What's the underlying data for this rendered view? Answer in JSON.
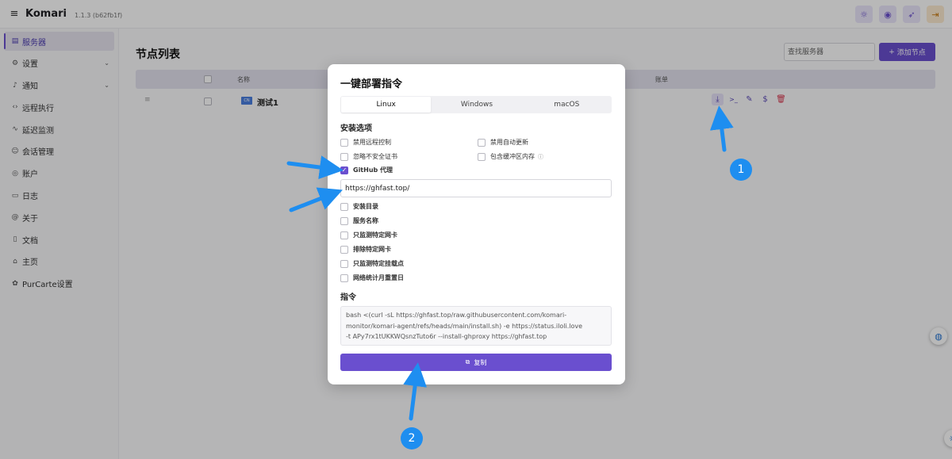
{
  "header": {
    "menu_icon": "hamburger-icon",
    "brand": "Komari",
    "version": "1.1.3 (b62fb1f)",
    "actions": [
      {
        "icon": "sun-icon",
        "glyph": "☼"
      },
      {
        "icon": "palette-icon",
        "glyph": "◉"
      },
      {
        "icon": "rocket-icon",
        "glyph": "➶"
      },
      {
        "icon": "logout-icon",
        "glyph": "⇥"
      }
    ]
  },
  "sidebar": {
    "items": [
      {
        "label": "服务器",
        "icon": "server-icon",
        "glyph": "▤",
        "active": true
      },
      {
        "label": "设置",
        "icon": "gear-icon",
        "glyph": "⚙",
        "chevron": true
      },
      {
        "label": "通知",
        "icon": "bell-icon",
        "glyph": "♪",
        "chevron": true
      },
      {
        "label": "远程执行",
        "icon": "code-icon",
        "glyph": "‹›"
      },
      {
        "label": "延迟监测",
        "icon": "pulse-icon",
        "glyph": "∿"
      },
      {
        "label": "会话管理",
        "icon": "users-icon",
        "glyph": "☺"
      },
      {
        "label": "账户",
        "icon": "user-circle-icon",
        "glyph": "◎"
      },
      {
        "label": "日志",
        "icon": "file-icon",
        "glyph": "▭"
      },
      {
        "label": "关于",
        "icon": "at-icon",
        "glyph": "@"
      },
      {
        "label": "文档",
        "icon": "book-icon",
        "glyph": "▯"
      },
      {
        "label": "主页",
        "icon": "home-icon",
        "glyph": "⌂"
      },
      {
        "label": "PurCarte设置",
        "icon": "palette-icon",
        "glyph": "✿"
      }
    ]
  },
  "main": {
    "title": "节点列表",
    "search_placeholder": "查找服务器",
    "add_button": "添加节点",
    "table": {
      "headers": {
        "name": "名称",
        "billing": "账单"
      },
      "rows": [
        {
          "flag": "CN",
          "name": "测试1"
        }
      ]
    },
    "row_actions": [
      {
        "icon": "download-icon",
        "glyph": "⤓"
      },
      {
        "icon": "terminal-icon",
        "glyph": ">_"
      },
      {
        "icon": "edit-icon",
        "glyph": "✎"
      },
      {
        "icon": "dollar-icon",
        "glyph": "$"
      },
      {
        "icon": "trash-icon",
        "glyph": "🗑"
      }
    ]
  },
  "dialog": {
    "title": "一键部署指令",
    "tabs": [
      "Linux",
      "Windows",
      "macOS"
    ],
    "active_tab": "Linux",
    "install_options_label": "安装选项",
    "options": {
      "disable_remote": "禁用远程控制",
      "disable_auto_update": "禁用自动更新",
      "ignore_cert": "忽略不安全证书",
      "include_buffer": "包含缓冲区内存",
      "github_proxy": "GitHub 代理",
      "install_dir": "安装目录",
      "service_name": "服务名称",
      "only_nic": "只监测特定网卡",
      "exclude_nic": "排除特定网卡",
      "only_mount": "只监测特定挂载点",
      "reset_day": "网络统计月重置日"
    },
    "github_proxy_checked": true,
    "proxy_value": "https://ghfast.top/",
    "command_label": "指令",
    "command_lines": [
      "bash <(curl -sL https://ghfast.top/raw.githubusercontent.com/komari-",
      "monitor/komari-agent/refs/heads/main/install.sh) -e https://status.iloli.love",
      "-t APy7rx1tUKKWQsnzTuto6r --install-ghproxy https://ghfast.top"
    ],
    "copy_button": "复制"
  },
  "annotations": {
    "badge_1": "1",
    "badge_2": "2",
    "arrow_color": "#1e8ef0"
  },
  "colors": {
    "accent": "#6a4fcf",
    "danger": "#d6334b"
  }
}
